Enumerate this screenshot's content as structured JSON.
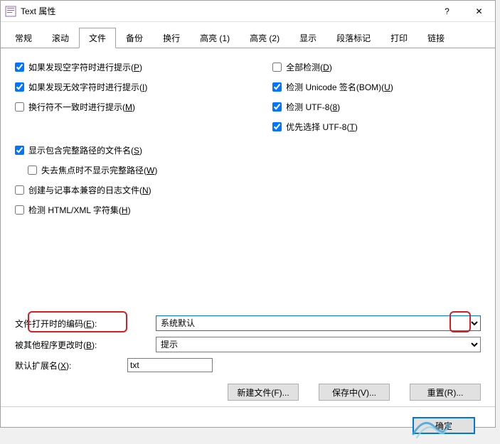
{
  "titlebar": {
    "title": "Text 属性",
    "help": "?",
    "close": "✕"
  },
  "tabs": [
    "常规",
    "滚动",
    "文件",
    "备份",
    "换行",
    "高亮 (1)",
    "高亮 (2)",
    "显示",
    "段落标记",
    "打印",
    "链接"
  ],
  "active_tab_index": 2,
  "left_checks": [
    {
      "label": "如果发现空字符时进行提示(",
      "hot": "P",
      "checked": true,
      "indent": false
    },
    {
      "label": "如果发现无效字符时进行提示(",
      "hot": "I",
      "checked": true,
      "indent": false
    },
    {
      "label": "换行符不一致时进行提示(",
      "hot": "M",
      "checked": false,
      "indent": false
    },
    {
      "spacer": true
    },
    {
      "label": "显示包含完整路径的文件名(",
      "hot": "S",
      "checked": true,
      "indent": false
    },
    {
      "label": "失去焦点时不显示完整路径(",
      "hot": "W",
      "checked": false,
      "indent": true
    },
    {
      "label": "创建与记事本兼容的日志文件(",
      "hot": "N",
      "checked": false,
      "indent": false
    },
    {
      "label": "检测 HTML/XML 字符集(",
      "hot": "H",
      "checked": false,
      "indent": false
    }
  ],
  "right_checks": [
    {
      "label": "全部检测(",
      "hot": "D",
      "checked": false
    },
    {
      "label": "检测 Unicode 签名(BOM)(",
      "hot": "U",
      "checked": true
    },
    {
      "label": "检测 UTF-8(",
      "hot": "8",
      "checked": true
    },
    {
      "label": "优先选择 UTF-8(",
      "hot": "T",
      "checked": true
    }
  ],
  "form": {
    "encoding_label_pre": "文件打开时的编码(",
    "encoding_hot": "E",
    "encoding_label_post": "):",
    "encoding_value": "系统默认",
    "changed_label_pre": "被其他程序更改时(",
    "changed_hot": "B",
    "changed_label_post": "):",
    "changed_value": "提示",
    "ext_label_pre": "默认扩展名(",
    "ext_hot": "X",
    "ext_label_post": "):",
    "ext_value": "txt"
  },
  "buttons": {
    "newfile": "新建文件(F)...",
    "saving": "保存中(V)...",
    "reset": "重置(R)...",
    "ok": "确定"
  }
}
